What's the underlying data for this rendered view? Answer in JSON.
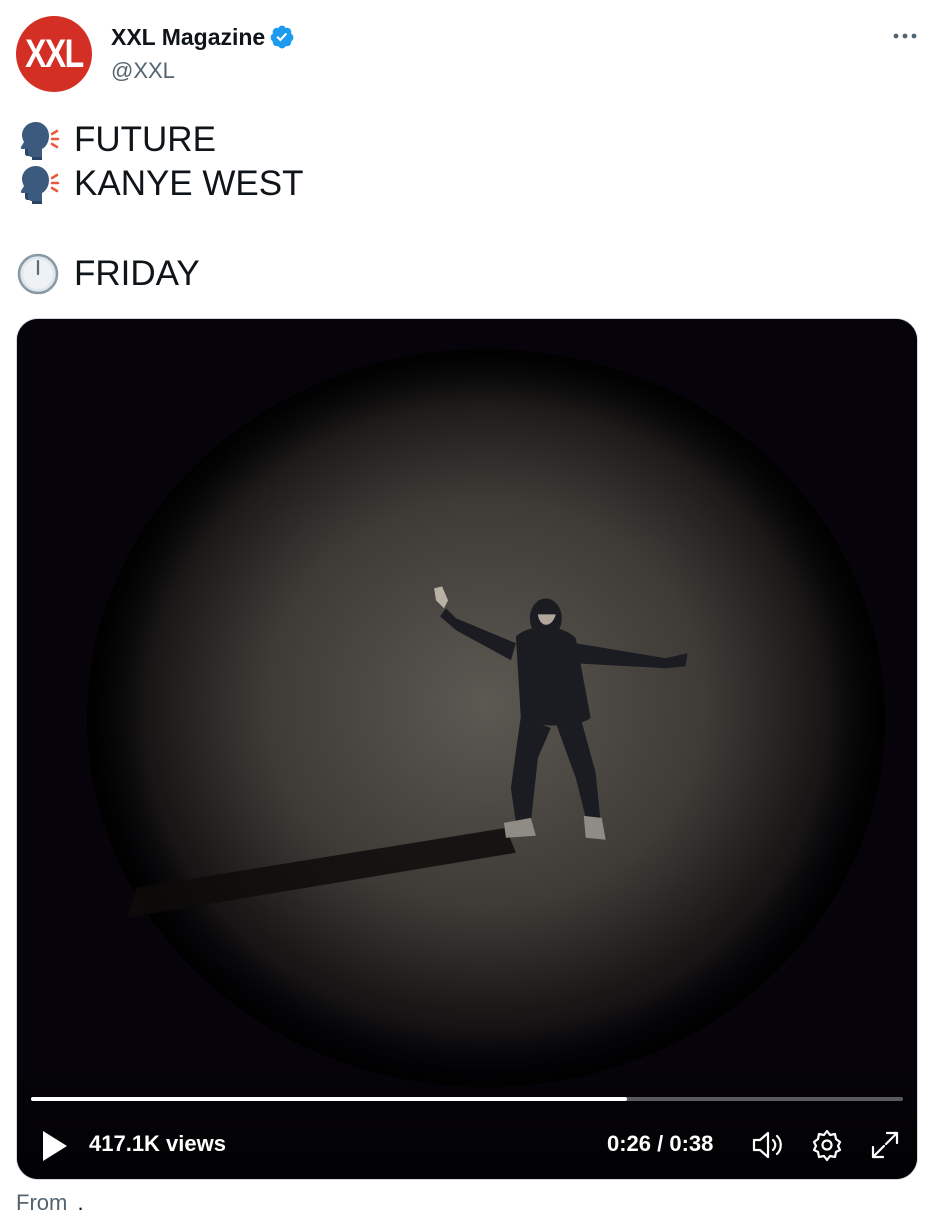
{
  "author": {
    "avatar_text": "XXL",
    "display_name": "XXL Magazine",
    "handle": "@XXL",
    "verified": true
  },
  "tweet": {
    "lines": [
      {
        "icon": "speaking-head-icon",
        "text": "FUTURE"
      },
      {
        "icon": "speaking-head-icon",
        "text": "KANYE WEST"
      },
      {
        "icon": "clock-icon",
        "text": "FRIDAY"
      }
    ]
  },
  "video": {
    "views": "417.1K views",
    "time": "0:26 / 0:38",
    "progress": 0.684
  },
  "footer": {
    "from_label": "From",
    "from_source": "."
  },
  "colors": {
    "brand_red": "#d42f25",
    "verified_blue": "#1d9bf0",
    "text_primary": "#0f1419",
    "text_secondary": "#536471"
  }
}
